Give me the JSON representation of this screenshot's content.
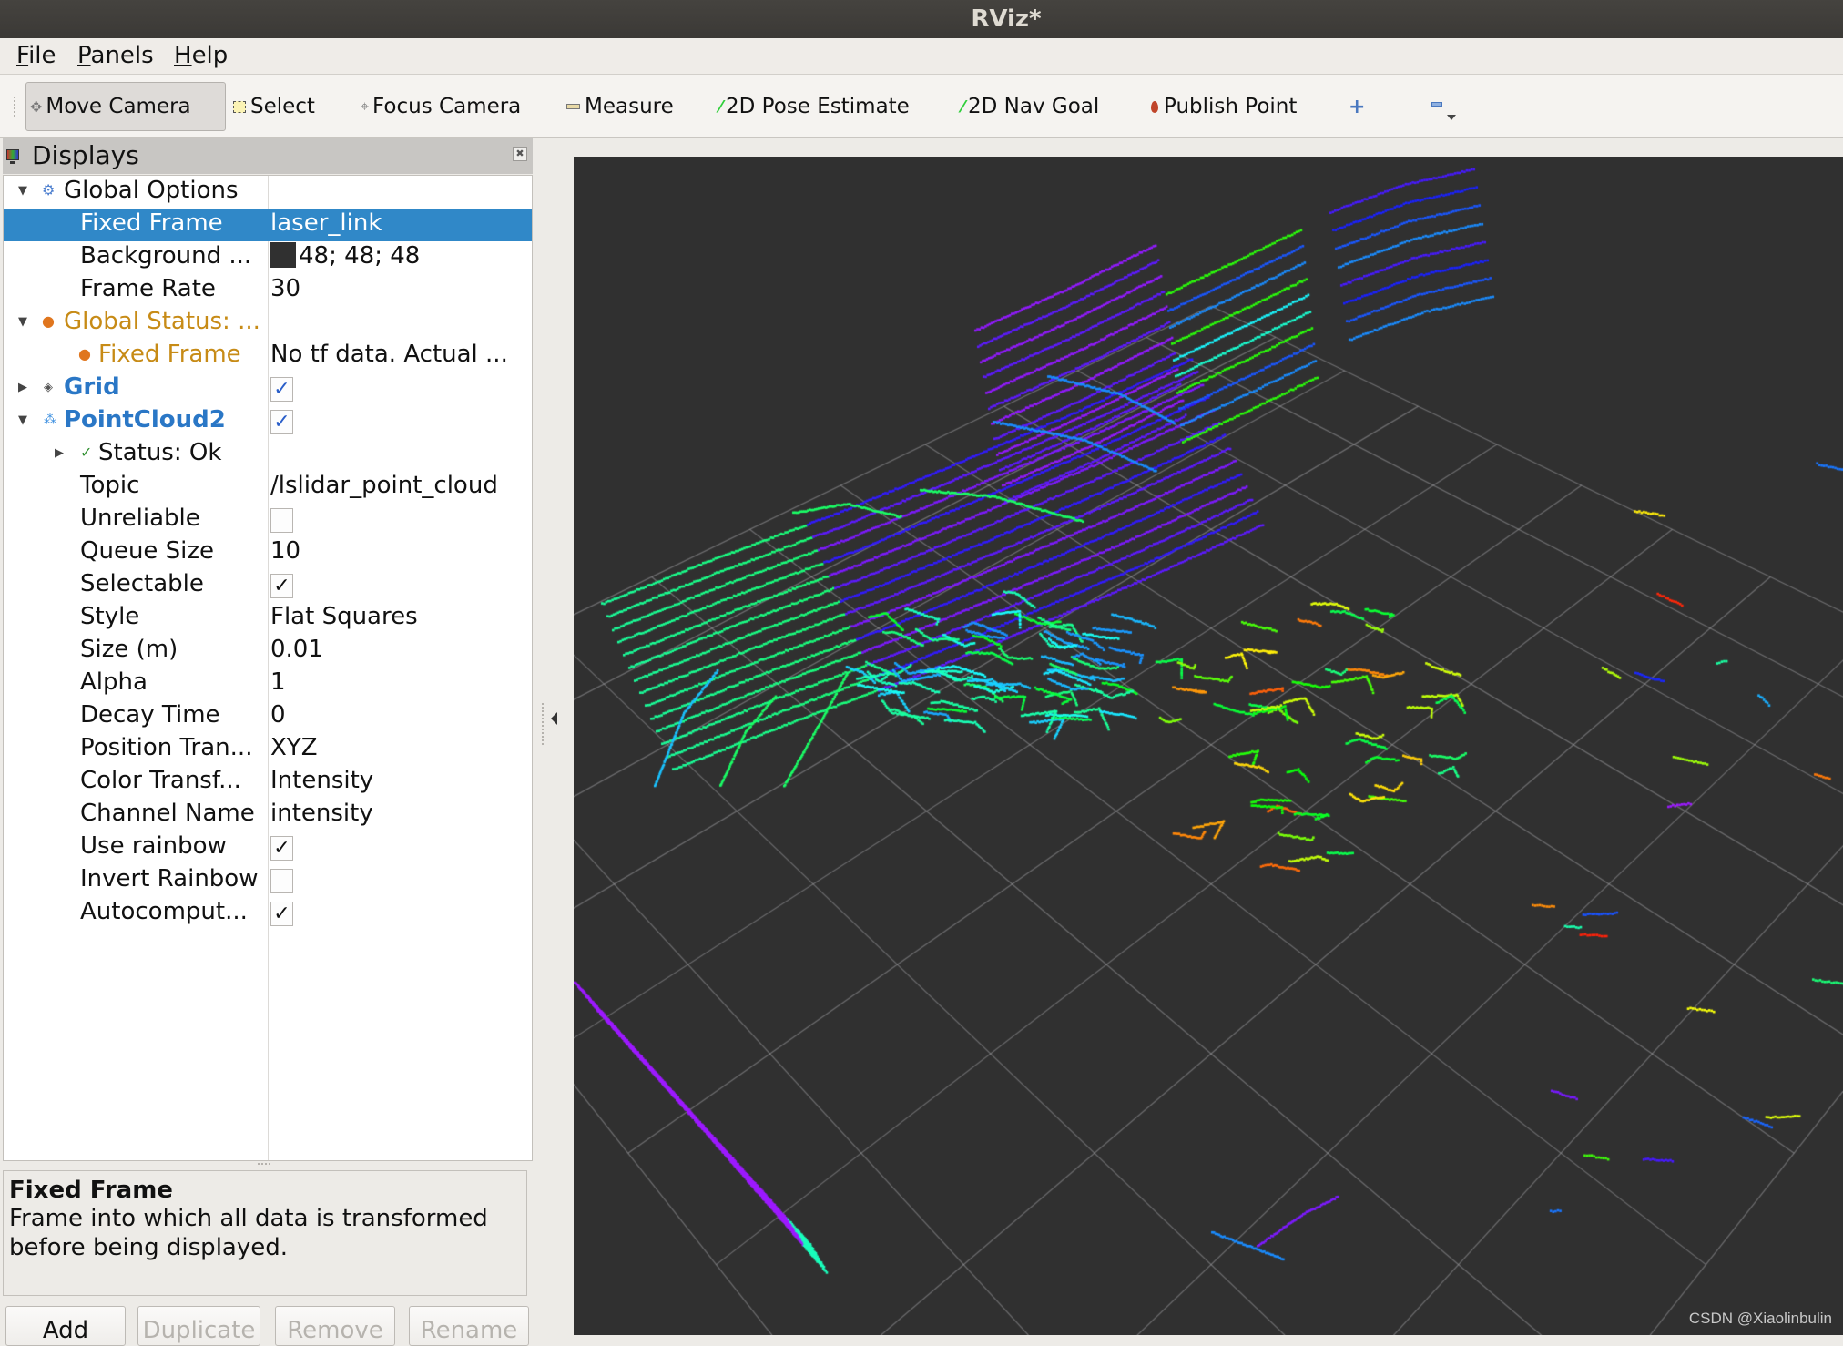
{
  "window": {
    "title": "RViz*"
  },
  "menu": [
    {
      "label": "File",
      "mnemonic": "F",
      "rest": "ile"
    },
    {
      "label": "Panels",
      "mnemonic": "P",
      "rest": "anels"
    },
    {
      "label": "Help",
      "mnemonic": "H",
      "rest": "elp"
    }
  ],
  "toolbar": {
    "tools": [
      {
        "label": "Move Camera",
        "icon": "move-camera-icon",
        "active": true
      },
      {
        "label": "Select",
        "icon": "select-icon",
        "active": false
      },
      {
        "label": "Focus Camera",
        "icon": "focus-camera-icon",
        "active": false
      },
      {
        "label": "Measure",
        "icon": "measure-icon",
        "active": false
      },
      {
        "label": "2D Pose Estimate",
        "icon": "pose-estimate-icon",
        "active": false
      },
      {
        "label": "2D Nav Goal",
        "icon": "nav-goal-icon",
        "active": false
      },
      {
        "label": "Publish Point",
        "icon": "publish-point-icon",
        "active": false
      }
    ],
    "add_tool_icon": "plus-icon",
    "remove_tool_icon": "minus-icon"
  },
  "displays_panel": {
    "title": "Displays",
    "tree": {
      "global_options": {
        "label": "Global Options"
      },
      "fixed_frame": {
        "label": "Fixed Frame",
        "value": "laser_link"
      },
      "background_color": {
        "label": "Background ...",
        "value": "48; 48; 48",
        "swatch": "#303030"
      },
      "frame_rate": {
        "label": "Frame Rate",
        "value": "30"
      },
      "global_status": {
        "label": "Global Status: ..."
      },
      "status_fixed_frame": {
        "label": "Fixed Frame",
        "value": "No tf data.  Actual ..."
      },
      "grid": {
        "label": "Grid",
        "checked": true
      },
      "pointcloud2": {
        "label": "PointCloud2",
        "checked": true
      },
      "status_ok": {
        "label": "Status: Ok"
      },
      "topic": {
        "label": "Topic",
        "value": "/lslidar_point_cloud"
      },
      "unreliable": {
        "label": "Unreliable",
        "checked": false
      },
      "queue_size": {
        "label": "Queue Size",
        "value": "10"
      },
      "selectable": {
        "label": "Selectable",
        "checked": true
      },
      "style": {
        "label": "Style",
        "value": "Flat Squares"
      },
      "size": {
        "label": "Size (m)",
        "value": "0.01"
      },
      "alpha": {
        "label": "Alpha",
        "value": "1"
      },
      "decay_time": {
        "label": "Decay Time",
        "value": "0"
      },
      "position_transformer": {
        "label": "Position Tran...",
        "value": "XYZ"
      },
      "color_transformer": {
        "label": "Color Transf...",
        "value": "Intensity"
      },
      "channel_name": {
        "label": "Channel Name",
        "value": "intensity"
      },
      "use_rainbow": {
        "label": "Use rainbow",
        "checked": true
      },
      "invert_rainbow": {
        "label": "Invert Rainbow",
        "checked": false
      },
      "autocompute": {
        "label": "Autocomput...",
        "checked": true
      }
    },
    "description": {
      "title": "Fixed Frame",
      "text": "Frame into which all data is transformed before being displayed."
    },
    "buttons": [
      {
        "label": "Add",
        "enabled": true
      },
      {
        "label": "Duplicate",
        "enabled": false
      },
      {
        "label": "Remove",
        "enabled": false
      },
      {
        "label": "Rename",
        "enabled": false
      }
    ]
  },
  "viewport": {
    "background": "#303030",
    "grid_color": "#a0a0a4",
    "grid_cells": 10,
    "watermark": "CSDN @Xiaolinbulin"
  },
  "colors": {
    "selection": "#3088c8",
    "warning": "#c78b16",
    "display_name": "#2a77c6"
  }
}
